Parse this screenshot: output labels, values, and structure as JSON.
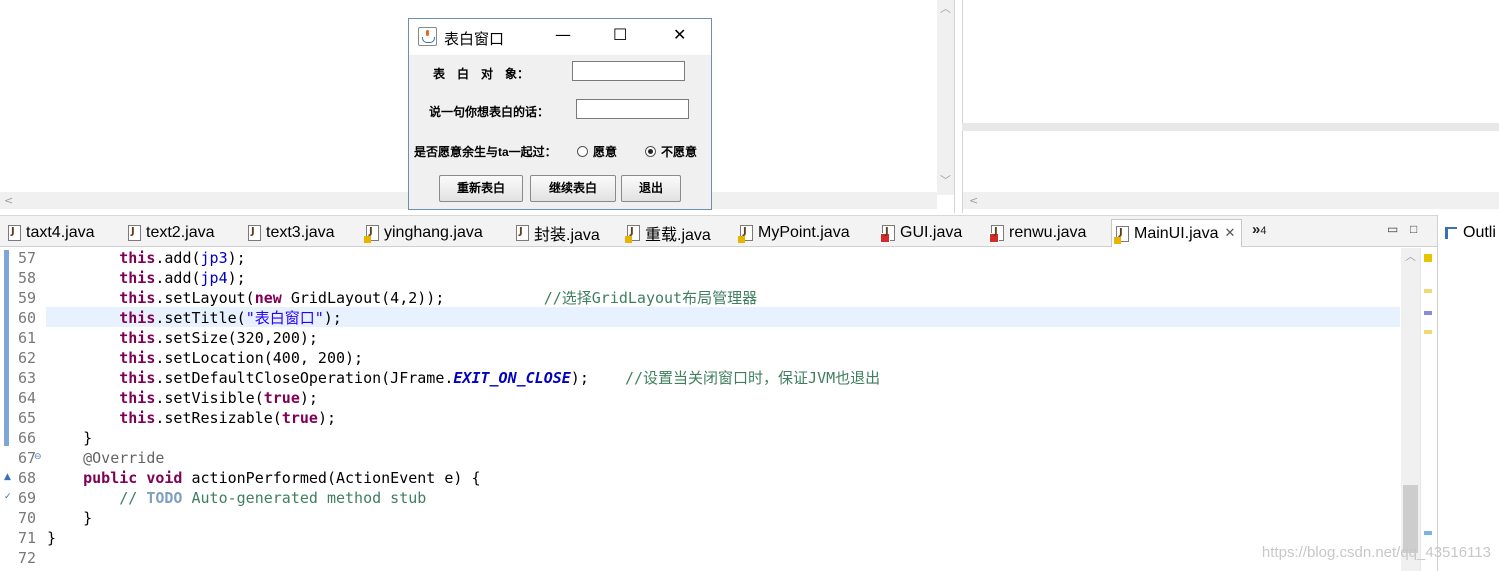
{
  "editor": {
    "tabs": [
      {
        "label": "taxt4.java",
        "state": "normal"
      },
      {
        "label": "text2.java",
        "state": "normal"
      },
      {
        "label": "text3.java",
        "state": "normal"
      },
      {
        "label": "yinghang.java",
        "state": "warning"
      },
      {
        "label": "封装.java",
        "state": "normal"
      },
      {
        "label": "重载.java",
        "state": "warning"
      },
      {
        "label": "MyPoint.java",
        "state": "warning"
      },
      {
        "label": "GUI.java",
        "state": "error"
      },
      {
        "label": "renwu.java",
        "state": "error"
      },
      {
        "label": "MainUI.java",
        "state": "active"
      }
    ],
    "more_tabs_label": "»",
    "more_tabs_count": "4",
    "minimize": "▭",
    "maximize": "□",
    "close_tab": "✕",
    "lines": [
      {
        "n": "57"
      },
      {
        "n": "58"
      },
      {
        "n": "59"
      },
      {
        "n": "60"
      },
      {
        "n": "61"
      },
      {
        "n": "62"
      },
      {
        "n": "63"
      },
      {
        "n": "64"
      },
      {
        "n": "65"
      },
      {
        "n": "66"
      },
      {
        "n": "67"
      },
      {
        "n": "68"
      },
      {
        "n": "69"
      },
      {
        "n": "70"
      },
      {
        "n": "71"
      },
      {
        "n": "72"
      }
    ],
    "code": {
      "l57": {
        "kw": "this",
        "rest1": ".add(",
        "fld": "jp3",
        "rest2": ");"
      },
      "l58": {
        "kw": "this",
        "rest1": ".add(",
        "fld": "jp4",
        "rest2": ");"
      },
      "l59": {
        "kw": "this",
        "rest1": ".setLayout(",
        "kw2": "new",
        "rest2": " GridLayout(4,2));           ",
        "cmt": "//选择GridLayout布局管理器"
      },
      "l60": {
        "kw": "this",
        "rest1": ".setTitle(",
        "str": "\"表白窗口\"",
        "rest2": ");"
      },
      "l61": {
        "kw": "this",
        "rest1": ".setSize(320,200);"
      },
      "l62": {
        "kw": "this",
        "rest1": ".setLocation(400, 200);"
      },
      "l63": {
        "kw": "this",
        "rest1": ".setDefaultCloseOperation(JFrame.",
        "sfld": "EXIT_ON_CLOSE",
        "rest2": ");    ",
        "cmt": "//设置当关闭窗口时，保证JVM也退出"
      },
      "l64": {
        "kw": "this",
        "rest1": ".setVisible(",
        "kw2": "true",
        "rest2": ");"
      },
      "l65": {
        "kw": "this",
        "rest1": ".setResizable(",
        "kw2": "true",
        "rest2": ");"
      },
      "l66": {
        "text": "}"
      },
      "l67": {
        "ann": "@Override"
      },
      "l68": {
        "kw": "public",
        "kw2": "void",
        "rest1": " actionPerformed(ActionEvent e) {"
      },
      "l69": {
        "cmt1": "// ",
        "todo": "TODO",
        "cmt2": " Auto-generated method stub"
      },
      "l70": {
        "text": "}"
      },
      "l71": {
        "text": "}"
      },
      "l72": {
        "text": ""
      }
    },
    "watermark": "https://blog.csdn.net/qq_43516113"
  },
  "outline": {
    "label": "Outli"
  },
  "window": {
    "title": "表白窗口",
    "min": "—",
    "max": "☐",
    "close": "✕",
    "label_target": "表　白　对　象：",
    "label_words": "说一句你想表白的话：",
    "label_question": "是否愿意余生与ta一起过：",
    "field_target_value": "",
    "field_words_value": "",
    "radio_yes": {
      "label": "愿意",
      "selected": false
    },
    "radio_no": {
      "label": "不愿意",
      "selected": true
    },
    "btn_retry": "重新表白",
    "btn_continue": "继续表白",
    "btn_exit": "退出"
  },
  "colors": {
    "keyword": "#7f0055",
    "string": "#2a00ff",
    "comment": "#3f7f5f",
    "field": "#0000c0",
    "current_line": "#e8f2fe"
  }
}
